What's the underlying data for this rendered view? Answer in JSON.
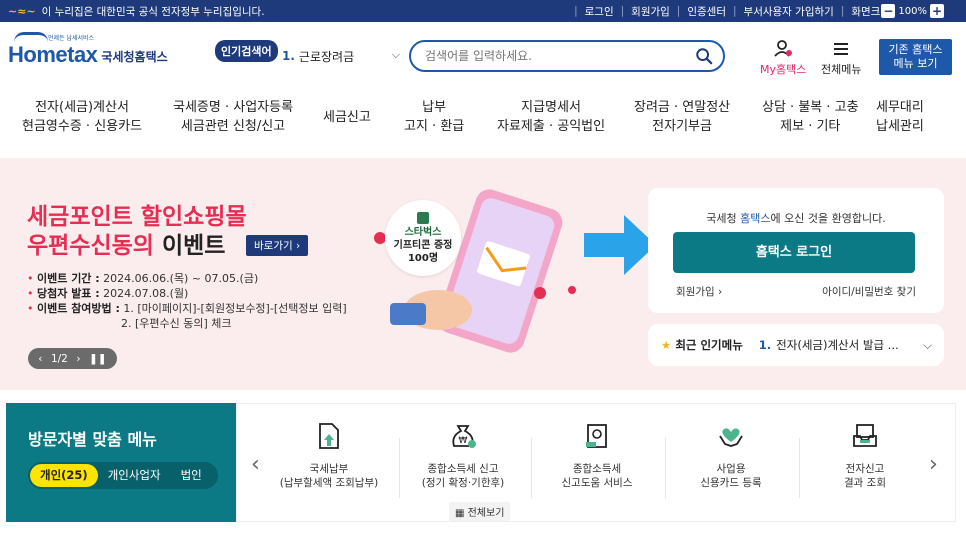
{
  "topbar": {
    "gov_notice": "이 누리집은 대한민국 공식 전자정부 누리집입니다.",
    "links": [
      "로그인",
      "회원가입",
      "인증센터",
      "부서사용자 가입하기",
      "화면크기"
    ],
    "zoom": "100%"
  },
  "header": {
    "logo_text": "Hometax",
    "logo_sub": "국세청홈택스",
    "logo_tiny": "언제든 납세서비스",
    "popular_badge": "인기검색어",
    "popular_num": "1.",
    "popular_term": "근로장려금",
    "search_placeholder": "검색어를 입력하세요.",
    "my_home": "My홈택스",
    "all_menu": "전체메뉴",
    "old_menu_l1": "기존 홈택스",
    "old_menu_l2": "메뉴 보기"
  },
  "gnb": [
    {
      "l1": "전자(세금)계산서",
      "l2": "현금영수증 · 신용카드"
    },
    {
      "l1": "국세증명 · 사업자등록",
      "l2": "세금관련 신청/신고"
    },
    {
      "l1": "세금신고",
      "l2": ""
    },
    {
      "l1": "납부",
      "l2": "고지 · 환급"
    },
    {
      "l1": "지급명세서",
      "l2": "자료제출 · 공익법인"
    },
    {
      "l1": "장려금 · 연말정산",
      "l2": "전자기부금"
    },
    {
      "l1": "상담 · 불복 · 고충",
      "l2": "제보 · 기타"
    },
    {
      "l1": "세무대리",
      "l2": "납세관리"
    }
  ],
  "hero": {
    "title_l1": "세금포인트 할인쇼핑몰",
    "title_l2a": "우편수신동의",
    "title_l2b": " 이벤트",
    "goto": "바로가기 ›",
    "info": [
      {
        "label": "이벤트 기간 :",
        "value": " 2024.06.06.(목) ~ 07.05.(금)"
      },
      {
        "label": "당첨자 발표 :",
        "value": " 2024.07.08.(월)"
      },
      {
        "label": "이벤트 참여방법 :",
        "value": " 1. [마이페이지]-[회원정보수정]-[선택정보 입력]"
      }
    ],
    "info_cont": "2. [우편수신 동의] 체크",
    "pager": "1/2",
    "sticker_l1": "스타벅스",
    "sticker_l2": "기프티콘 증정",
    "sticker_l3": "100명"
  },
  "login": {
    "welcome_a": "국세청 ",
    "welcome_hl": "홈택스",
    "welcome_b": "에 오신 것을 환영합니다.",
    "button": "홈택스 로그인",
    "join": "회원가입 ›",
    "find": "아이디/비밀번호 찾기"
  },
  "popular_menu": {
    "label": "최근 인기메뉴",
    "num": "1.",
    "item": "전자(세금)계산서 발급 ..."
  },
  "visitor": {
    "title": "방문자별 맞춤 메뉴",
    "tabs": [
      "개인(25)",
      "개인사업자",
      "법인"
    ]
  },
  "quick": {
    "items": [
      {
        "l1": "국세납부",
        "l2": "(납부할세액 조회납부)",
        "icon": "document-upload-icon"
      },
      {
        "l1": "종합소득세 신고",
        "l2": "(정기 확정·기한후)",
        "icon": "money-bag-icon"
      },
      {
        "l1": "종합소득세",
        "l2": "신고도움 서비스",
        "icon": "document-help-icon"
      },
      {
        "l1": "사업용",
        "l2": "신용카드 등록",
        "icon": "heart-hands-icon"
      },
      {
        "l1": "전자신고",
        "l2": "결과 조회",
        "icon": "inbox-tray-icon"
      }
    ],
    "all_view": "전체보기"
  },
  "colors": {
    "navy": "#1e3a7b",
    "teal": "#0c7a85",
    "brand_blue": "#1e58a8",
    "event_red": "#e62e53",
    "hero_bg": "#fbeded"
  }
}
